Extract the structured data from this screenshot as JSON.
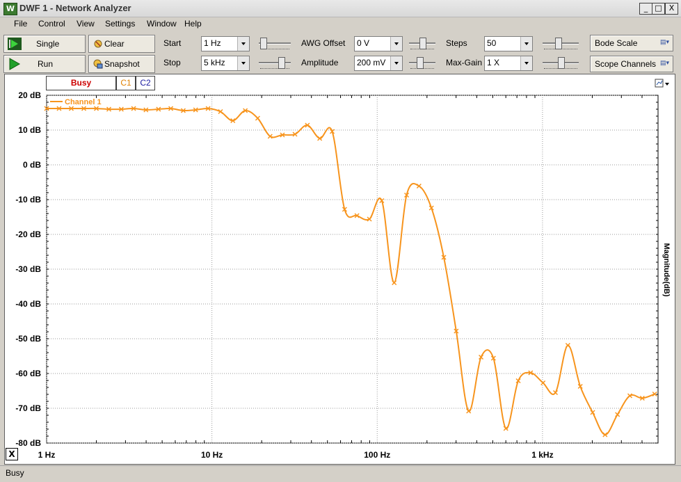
{
  "window": {
    "title": "DWF 1 - Network Analyzer",
    "icon_label": "W",
    "minimize": "_",
    "maximize": "□",
    "close": "X"
  },
  "menu": [
    "File",
    "Control",
    "View",
    "Settings",
    "Window",
    "Help"
  ],
  "toolbar": {
    "single_label": "Single",
    "run_label": "Run",
    "clear_label": "Clear",
    "snapshot_label": "Snapshot",
    "start_label": "Start",
    "start_value": "1 Hz",
    "stop_label": "Stop",
    "stop_value": "5 kHz",
    "awg_offset_label": "AWG Offset",
    "awg_offset_value": "0 V",
    "amplitude_label": "Amplitude",
    "amplitude_value": "200 mV",
    "steps_label": "Steps",
    "steps_value": "50",
    "maxgain_label": "Max-Gain",
    "maxgain_value": "1 X",
    "bode_scale_label": "Bode Scale",
    "scope_channels_label": "Scope Channels"
  },
  "plot_tabs": {
    "status": "Busy",
    "c1": "C1",
    "c2": "C2"
  },
  "status_bar": {
    "text": "Busy"
  },
  "colors": {
    "channel1": "#f7941d",
    "busy": "#cc0000",
    "c2": "#1a1aa0"
  },
  "chart_data": {
    "type": "line",
    "xscale": "log",
    "xlim": [
      1,
      5000
    ],
    "ylim": [
      -80,
      20
    ],
    "grid": true,
    "legend_position": "top-left",
    "xticks": [
      {
        "v": 1,
        "label": "1 Hz"
      },
      {
        "v": 10,
        "label": "10 Hz"
      },
      {
        "v": 100,
        "label": "100 Hz"
      },
      {
        "v": 1000,
        "label": "1 kHz"
      }
    ],
    "yticks": [
      {
        "v": 20,
        "label": "20 dB"
      },
      {
        "v": 10,
        "label": "10 dB"
      },
      {
        "v": 0,
        "label": "0 dB"
      },
      {
        "v": -10,
        "label": "-10 dB"
      },
      {
        "v": -20,
        "label": "-20 dB"
      },
      {
        "v": -30,
        "label": "-30 dB"
      },
      {
        "v": -40,
        "label": "-40 dB"
      },
      {
        "v": -50,
        "label": "-50 dB"
      },
      {
        "v": -60,
        "label": "-60 dB"
      },
      {
        "v": -70,
        "label": "-70 dB"
      },
      {
        "v": -80,
        "label": "-80 dB"
      }
    ],
    "ylabel": "Magnitude(dB)",
    "corner_label": "X",
    "series": [
      {
        "name": "Channel 1",
        "x": [
          1,
          1.19,
          1.41,
          1.68,
          2.0,
          2.38,
          2.83,
          3.36,
          3.99,
          4.75,
          5.64,
          6.71,
          7.97,
          9.48,
          11.27,
          13.39,
          15.92,
          18.92,
          22.5,
          26.7,
          31.8,
          37.8,
          44.9,
          53.4,
          63.5,
          75.4,
          89.7,
          106.6,
          126.7,
          150.6,
          179.0,
          212.8,
          252.9,
          300.6,
          357.3,
          424.7,
          504.8,
          600.0,
          713.2,
          847.7,
          1007.6,
          1197.6,
          1423.5,
          1692.0,
          2011.1,
          2390.3,
          2841.2,
          3377.1,
          4014.0,
          4771.0
        ],
        "y": [
          16.2,
          16.2,
          16.2,
          16.2,
          16.2,
          16.0,
          16.0,
          16.2,
          15.8,
          16.0,
          16.2,
          15.6,
          15.8,
          16.2,
          15.3,
          12.7,
          15.6,
          13.4,
          8.2,
          8.6,
          8.8,
          11.4,
          7.6,
          9.6,
          -12.8,
          -14.6,
          -15.6,
          -10.3,
          -33.9,
          -8.7,
          -6.1,
          -12.4,
          -26.6,
          -47.8,
          -70.8,
          -55.3,
          -55.6,
          -75.8,
          -62.1,
          -59.8,
          -62.7,
          -65.5,
          -51.9,
          -63.7,
          -71.2,
          -77.6,
          -71.8,
          -66.4,
          -67.1,
          -65.9
        ]
      }
    ]
  }
}
